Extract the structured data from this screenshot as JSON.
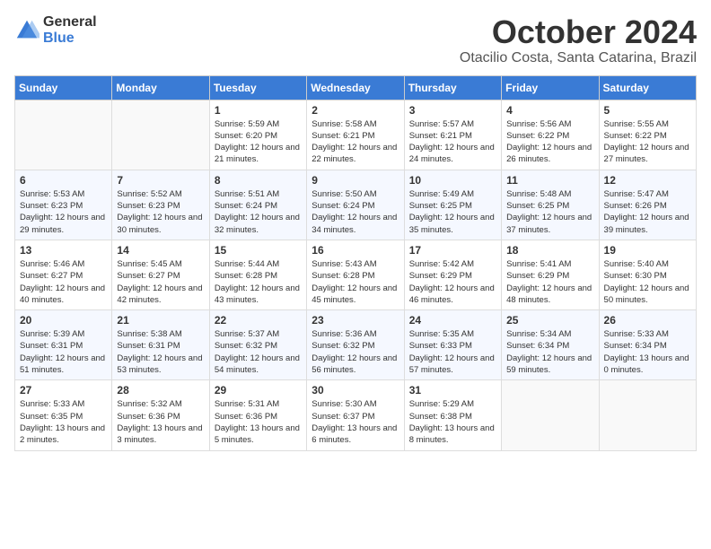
{
  "header": {
    "logo": {
      "text_general": "General",
      "text_blue": "Blue"
    },
    "month": "October 2024",
    "location": "Otacilio Costa, Santa Catarina, Brazil"
  },
  "days_of_week": [
    "Sunday",
    "Monday",
    "Tuesday",
    "Wednesday",
    "Thursday",
    "Friday",
    "Saturday"
  ],
  "weeks": [
    [
      {
        "day": "",
        "empty": true
      },
      {
        "day": "",
        "empty": true
      },
      {
        "day": "1",
        "sunrise": "5:59 AM",
        "sunset": "6:20 PM",
        "daylight": "12 hours and 21 minutes."
      },
      {
        "day": "2",
        "sunrise": "5:58 AM",
        "sunset": "6:21 PM",
        "daylight": "12 hours and 22 minutes."
      },
      {
        "day": "3",
        "sunrise": "5:57 AM",
        "sunset": "6:21 PM",
        "daylight": "12 hours and 24 minutes."
      },
      {
        "day": "4",
        "sunrise": "5:56 AM",
        "sunset": "6:22 PM",
        "daylight": "12 hours and 26 minutes."
      },
      {
        "day": "5",
        "sunrise": "5:55 AM",
        "sunset": "6:22 PM",
        "daylight": "12 hours and 27 minutes."
      }
    ],
    [
      {
        "day": "6",
        "sunrise": "5:53 AM",
        "sunset": "6:23 PM",
        "daylight": "12 hours and 29 minutes."
      },
      {
        "day": "7",
        "sunrise": "5:52 AM",
        "sunset": "6:23 PM",
        "daylight": "12 hours and 30 minutes."
      },
      {
        "day": "8",
        "sunrise": "5:51 AM",
        "sunset": "6:24 PM",
        "daylight": "12 hours and 32 minutes."
      },
      {
        "day": "9",
        "sunrise": "5:50 AM",
        "sunset": "6:24 PM",
        "daylight": "12 hours and 34 minutes."
      },
      {
        "day": "10",
        "sunrise": "5:49 AM",
        "sunset": "6:25 PM",
        "daylight": "12 hours and 35 minutes."
      },
      {
        "day": "11",
        "sunrise": "5:48 AM",
        "sunset": "6:25 PM",
        "daylight": "12 hours and 37 minutes."
      },
      {
        "day": "12",
        "sunrise": "5:47 AM",
        "sunset": "6:26 PM",
        "daylight": "12 hours and 39 minutes."
      }
    ],
    [
      {
        "day": "13",
        "sunrise": "5:46 AM",
        "sunset": "6:27 PM",
        "daylight": "12 hours and 40 minutes."
      },
      {
        "day": "14",
        "sunrise": "5:45 AM",
        "sunset": "6:27 PM",
        "daylight": "12 hours and 42 minutes."
      },
      {
        "day": "15",
        "sunrise": "5:44 AM",
        "sunset": "6:28 PM",
        "daylight": "12 hours and 43 minutes."
      },
      {
        "day": "16",
        "sunrise": "5:43 AM",
        "sunset": "6:28 PM",
        "daylight": "12 hours and 45 minutes."
      },
      {
        "day": "17",
        "sunrise": "5:42 AM",
        "sunset": "6:29 PM",
        "daylight": "12 hours and 46 minutes."
      },
      {
        "day": "18",
        "sunrise": "5:41 AM",
        "sunset": "6:29 PM",
        "daylight": "12 hours and 48 minutes."
      },
      {
        "day": "19",
        "sunrise": "5:40 AM",
        "sunset": "6:30 PM",
        "daylight": "12 hours and 50 minutes."
      }
    ],
    [
      {
        "day": "20",
        "sunrise": "5:39 AM",
        "sunset": "6:31 PM",
        "daylight": "12 hours and 51 minutes."
      },
      {
        "day": "21",
        "sunrise": "5:38 AM",
        "sunset": "6:31 PM",
        "daylight": "12 hours and 53 minutes."
      },
      {
        "day": "22",
        "sunrise": "5:37 AM",
        "sunset": "6:32 PM",
        "daylight": "12 hours and 54 minutes."
      },
      {
        "day": "23",
        "sunrise": "5:36 AM",
        "sunset": "6:32 PM",
        "daylight": "12 hours and 56 minutes."
      },
      {
        "day": "24",
        "sunrise": "5:35 AM",
        "sunset": "6:33 PM",
        "daylight": "12 hours and 57 minutes."
      },
      {
        "day": "25",
        "sunrise": "5:34 AM",
        "sunset": "6:34 PM",
        "daylight": "12 hours and 59 minutes."
      },
      {
        "day": "26",
        "sunrise": "5:33 AM",
        "sunset": "6:34 PM",
        "daylight": "13 hours and 0 minutes."
      }
    ],
    [
      {
        "day": "27",
        "sunrise": "5:33 AM",
        "sunset": "6:35 PM",
        "daylight": "13 hours and 2 minutes."
      },
      {
        "day": "28",
        "sunrise": "5:32 AM",
        "sunset": "6:36 PM",
        "daylight": "13 hours and 3 minutes."
      },
      {
        "day": "29",
        "sunrise": "5:31 AM",
        "sunset": "6:36 PM",
        "daylight": "13 hours and 5 minutes."
      },
      {
        "day": "30",
        "sunrise": "5:30 AM",
        "sunset": "6:37 PM",
        "daylight": "13 hours and 6 minutes."
      },
      {
        "day": "31",
        "sunrise": "5:29 AM",
        "sunset": "6:38 PM",
        "daylight": "13 hours and 8 minutes."
      },
      {
        "day": "",
        "empty": true
      },
      {
        "day": "",
        "empty": true
      }
    ]
  ],
  "labels": {
    "sunrise": "Sunrise:",
    "sunset": "Sunset:",
    "daylight": "Daylight:"
  }
}
